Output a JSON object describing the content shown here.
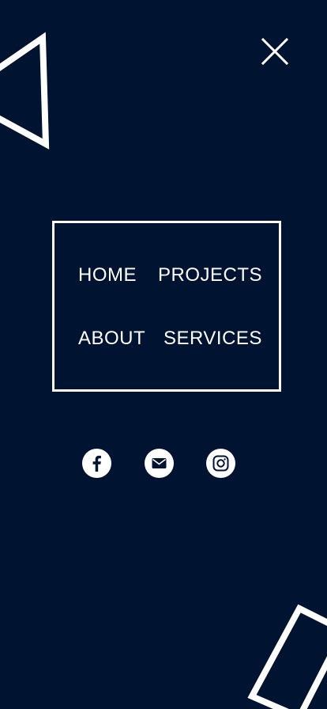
{
  "menu": {
    "close": {
      "icon": "close-icon"
    },
    "nav": [
      {
        "key": "home",
        "label": "HOME"
      },
      {
        "key": "projects",
        "label": "PROJECTS"
      },
      {
        "key": "about",
        "label": "ABOUT"
      },
      {
        "key": "services",
        "label": "SERVICES"
      }
    ]
  },
  "social": [
    {
      "icon": "facebook-icon"
    },
    {
      "icon": "email-icon"
    },
    {
      "icon": "instagram-icon"
    }
  ],
  "theme": {
    "background": "#001330",
    "foreground": "#ffffff"
  }
}
